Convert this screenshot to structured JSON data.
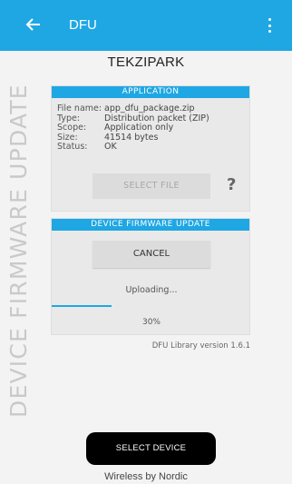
{
  "app_bar": {
    "title": "DFU",
    "back_icon": "arrow-back-icon",
    "menu_icon": "more-vert-icon",
    "color": "#1ea7e3"
  },
  "device_name": "TEKZIPARK",
  "section_title": "DEVICE FIRMWARE UPDATE",
  "application": {
    "header": "APPLICATION",
    "rows": [
      {
        "key": "File name:",
        "value": "app_dfu_package.zip"
      },
      {
        "key": "Type:",
        "value": "Distribution packet (ZIP)"
      },
      {
        "key": "Scope:",
        "value": "Application only"
      },
      {
        "key": "Size:",
        "value": "41514 bytes"
      },
      {
        "key": "Status:",
        "value": "OK"
      }
    ],
    "select_file_label": "SELECT FILE",
    "help_label": "?"
  },
  "dfu": {
    "header": "DEVICE FIRMWARE UPDATE",
    "cancel_label": "CANCEL",
    "status": "Uploading...",
    "progress_percent": 30,
    "progress_label": "30%"
  },
  "library_version": "DFU Library version 1.6.1",
  "select_device_label": "SELECT DEVICE",
  "footer": "Wireless by Nordic"
}
